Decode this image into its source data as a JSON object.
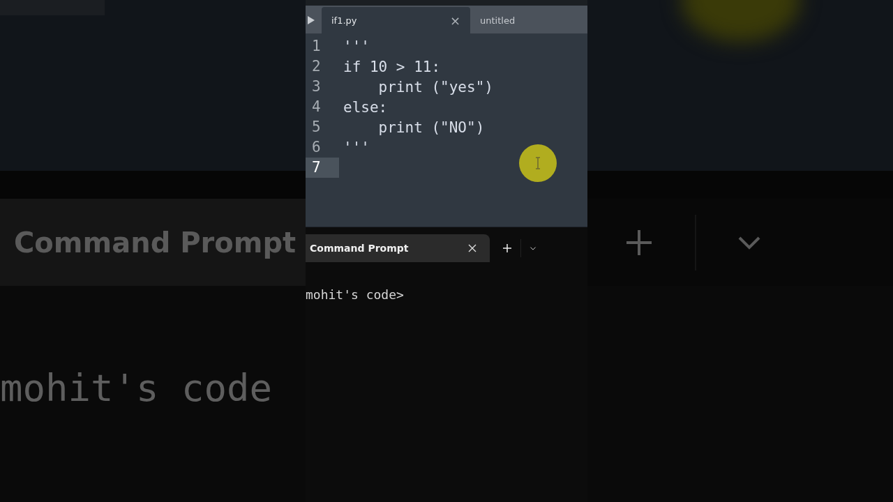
{
  "backdrop": {
    "tab_title": "Command Prompt",
    "prompt": "mohit's code"
  },
  "editor": {
    "tabs": [
      {
        "label": "if1.py",
        "selected": true,
        "close": "×"
      },
      {
        "label": "untitled",
        "selected": false
      }
    ],
    "lines": [
      {
        "number": "1",
        "text": "'''",
        "current": false
      },
      {
        "number": "2",
        "text": "if 10 > 11:",
        "current": false
      },
      {
        "number": "3",
        "text": "    print (\"yes\")",
        "current": false
      },
      {
        "number": "4",
        "text": "else:",
        "current": false
      },
      {
        "number": "5",
        "text": "    print (\"NO\")",
        "current": false
      },
      {
        "number": "6",
        "text": "'''",
        "current": false
      },
      {
        "number": "7",
        "current": true
      }
    ]
  },
  "terminal": {
    "tab": {
      "label": "Command Prompt",
      "selected": true
    },
    "prompt": "mohit's code>"
  }
}
